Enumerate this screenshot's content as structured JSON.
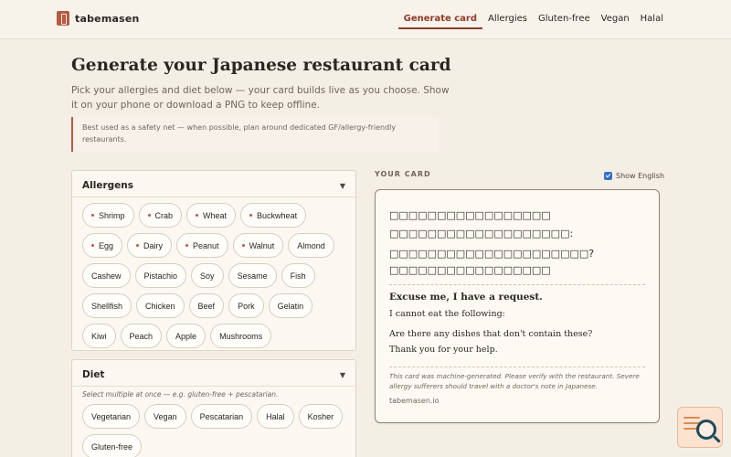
{
  "header": {
    "brand": "tabemasen",
    "nav": [
      "Generate card",
      "Allergies",
      "Gluten-free",
      "Vegan",
      "Halal"
    ]
  },
  "hero": {
    "title": "Generate your Japanese restaurant card",
    "subtitle": "Pick your allergies and diet below — your card builds live as you choose. Show it on your phone or download a PNG to keep offline.",
    "notice": "Best used as a safety net — when possible, plan around dedicated GF/allergy-friendly restaurants."
  },
  "allergens": {
    "title": "Allergens",
    "chips": [
      {
        "label": "Shrimp",
        "major": true
      },
      {
        "label": "Crab",
        "major": true
      },
      {
        "label": "Wheat",
        "major": true
      },
      {
        "label": "Buckwheat",
        "major": true
      },
      {
        "label": "Egg",
        "major": true
      },
      {
        "label": "Dairy",
        "major": true
      },
      {
        "label": "Peanut",
        "major": true
      },
      {
        "label": "Walnut",
        "major": true
      },
      {
        "label": "Almond",
        "major": false
      },
      {
        "label": "Cashew",
        "major": false
      },
      {
        "label": "Pistachio",
        "major": false
      },
      {
        "label": "Soy",
        "major": false
      },
      {
        "label": "Sesame",
        "major": false
      },
      {
        "label": "Fish",
        "major": false
      },
      {
        "label": "Shellfish",
        "major": false
      },
      {
        "label": "Chicken",
        "major": false
      },
      {
        "label": "Beef",
        "major": false
      },
      {
        "label": "Pork",
        "major": false
      },
      {
        "label": "Gelatin",
        "major": false
      },
      {
        "label": "Kiwi",
        "major": false
      },
      {
        "label": "Peach",
        "major": false
      },
      {
        "label": "Apple",
        "major": false
      },
      {
        "label": "Mushrooms",
        "major": false
      }
    ]
  },
  "diet": {
    "title": "Diet",
    "hint": "Select multiple at once — e.g. gluten-free + pescatarian.",
    "chips": [
      "Vegetarian",
      "Vegan",
      "Pescatarian",
      "Halal",
      "Kosher",
      "Gluten-free"
    ]
  },
  "card_panel": {
    "label": "YOUR CARD",
    "show_english": "Show English",
    "jp_lines": [
      "□□□□□□□□□□□□□□□□□",
      "□□□□□□□□□□□□□□□□□□□:",
      "□□□□□□□□□□□□□□□□□□□□□?",
      "□□□□□□□□□□□□□□□□□"
    ],
    "en_heading": "Excuse me, I have a request.",
    "en_line1": "I cannot eat the following:",
    "en_line2": "Are there any dishes that don't contain these?",
    "en_line3": "Thank you for your help.",
    "disclaimer": "This card was machine-generated. Please verify with the restaurant. Severe allergy sufferers should travel with a doctor's note in Japanese.",
    "site": "tabemasen.io"
  },
  "colors": {
    "accent": "#8e3b2a",
    "brand": "#b85a43",
    "background": "#f4efe4",
    "checkbox": "#3a6fc8"
  },
  "icons": {
    "logo": "brand-logo-icon",
    "caret": "chevron-down-icon",
    "widget": "magnifier-icon"
  }
}
